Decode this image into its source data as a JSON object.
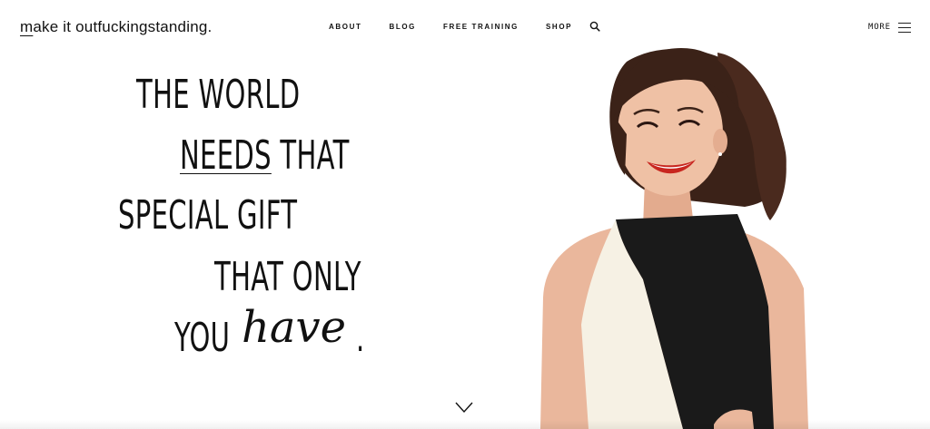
{
  "header": {
    "logo_first": "m",
    "logo_rest": "ake it outfuckingstanding.",
    "nav": [
      "ABOUT",
      "BLOG",
      "FREE TRAINING",
      "SHOP"
    ],
    "more_label": "MORE",
    "search_icon": "search-icon",
    "menu_icon": "hamburger-menu-icon"
  },
  "hero": {
    "line1": "THE WORLD",
    "line2_underlined": "NEEDS",
    "line2_rest": " THAT",
    "line3": "SPECIAL GIFT",
    "line4": "THAT ONLY",
    "line5": "YOU",
    "line5_script": "have",
    "line5_end": ".",
    "scroll_icon": "chevron-down-icon"
  },
  "colors": {
    "text": "#111111",
    "background": "#ffffff",
    "dress_black": "#1a1a1a",
    "dress_cream": "#f6f1e4",
    "skin": "#eab79c",
    "hair": "#3b2218",
    "lips": "#c8261f"
  }
}
